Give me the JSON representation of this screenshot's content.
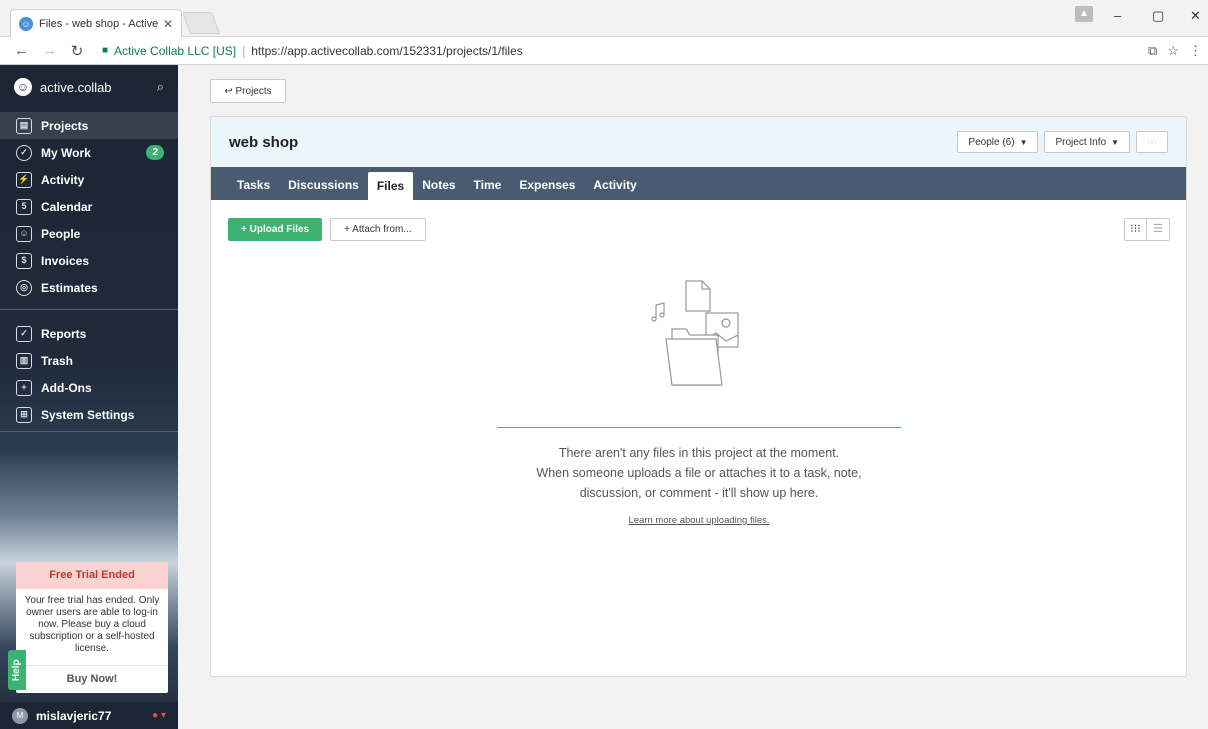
{
  "browser": {
    "tab_title": "Files - web shop - Active",
    "tab_close": "✕",
    "secure_label": "Active Collab LLC [US]",
    "url": "https://app.activecollab.com/152331/projects/1/files"
  },
  "sidebar": {
    "brand": "active.collab",
    "items": [
      {
        "label": "Projects",
        "icon": "projects-icon",
        "glyph": "▤"
      },
      {
        "label": "My Work",
        "icon": "check-circle-icon",
        "glyph": "✓",
        "badge": "2"
      },
      {
        "label": "Activity",
        "icon": "activity-icon",
        "glyph": "⚡"
      },
      {
        "label": "Calendar",
        "icon": "calendar-icon",
        "glyph": "5"
      },
      {
        "label": "People",
        "icon": "people-icon",
        "glyph": "☺"
      },
      {
        "label": "Invoices",
        "icon": "invoice-icon",
        "glyph": "$"
      },
      {
        "label": "Estimates",
        "icon": "estimates-icon",
        "glyph": "◎"
      },
      {
        "label": "Reports",
        "icon": "reports-icon",
        "glyph": "✓"
      },
      {
        "label": "Trash",
        "icon": "trash-icon",
        "glyph": "▥"
      },
      {
        "label": "Add-Ons",
        "icon": "addons-icon",
        "glyph": "+"
      },
      {
        "label": "System Settings",
        "icon": "settings-icon",
        "glyph": "⊞"
      }
    ],
    "trial": {
      "title": "Free Trial Ended",
      "body": "Your free trial has ended. Only owner users are able to log-in now. Please buy a cloud subscription or a self-hosted license.",
      "button": "Buy Now!"
    },
    "help": "Help",
    "user": {
      "initial": "M",
      "name": "mislavjeric77"
    }
  },
  "main": {
    "back_label": "↩ Projects",
    "project_title": "web shop",
    "people_btn": "People (6)",
    "info_btn": "Project Info",
    "more_btn": "···",
    "tabs": [
      "Tasks",
      "Discussions",
      "Files",
      "Notes",
      "Time",
      "Expenses",
      "Activity"
    ],
    "active_tab": "Files",
    "upload_btn": "+ Upload Files",
    "attach_btn": "+ Attach from...",
    "empty_line1": "There aren't any files in this project at the moment.",
    "empty_line2": "When someone uploads a file or attaches it to a task, note,",
    "empty_line3": "discussion, or comment - it'll show up here.",
    "learn_link": "Learn more about uploading files."
  },
  "colors": {
    "accent_green": "#3cb371",
    "tabs_bg": "#485b70",
    "header_bg": "#eaf5fc",
    "sidebar_bg": "#1b2533"
  }
}
